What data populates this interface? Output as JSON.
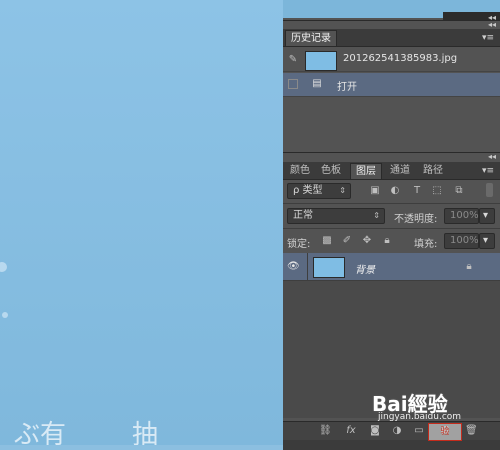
{
  "canvas": {
    "text_left": "ぶ有",
    "text_right": "抽"
  },
  "history_panel": {
    "tab_label": "历史记录",
    "snapshot_name": "201262541385983.jpg",
    "steps": [
      {
        "label": "打开"
      }
    ]
  },
  "layers_panel": {
    "tabs": [
      {
        "label": "颜色",
        "active": false
      },
      {
        "label": "色板",
        "active": false
      },
      {
        "label": "图层",
        "active": true
      },
      {
        "label": "通道",
        "active": false
      },
      {
        "label": "路径",
        "active": false
      }
    ],
    "filter": {
      "value": "类型"
    },
    "blend_mode": {
      "value": "正常"
    },
    "opacity": {
      "label": "不透明度:",
      "value": "100%"
    },
    "lock": {
      "label": "锁定:"
    },
    "fill": {
      "label": "填充:",
      "value": "100%"
    },
    "layers": [
      {
        "name": "背景",
        "visible": true,
        "locked": true
      }
    ]
  },
  "watermark": {
    "brand": "Bai經验",
    "site": "jingyan.baidu.com",
    "badge": "验"
  },
  "colors": {
    "panel": "#535353",
    "selection": "#5b6a82",
    "thumbnail": "#7fbde4"
  }
}
